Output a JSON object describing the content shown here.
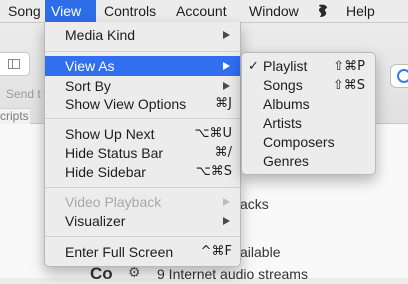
{
  "menubar": {
    "items": [
      {
        "label": "Song"
      },
      {
        "label": "View"
      },
      {
        "label": "Controls"
      },
      {
        "label": "Account"
      },
      {
        "label": "Window"
      },
      {
        "label": "Help"
      }
    ],
    "script_icon": "scroll-icon"
  },
  "background": {
    "send_to": "Send t",
    "scripts": "cripts",
    "lines": [
      "acks",
      "ailable",
      "Co",
      "9 Internet audio streams"
    ]
  },
  "view_menu": {
    "items": [
      {
        "label": "Media Kind",
        "shortcut": "",
        "submenu": true
      },
      {
        "label": "View As",
        "shortcut": "",
        "submenu": true
      },
      {
        "label": "Sort By",
        "shortcut": "",
        "submenu": true
      },
      {
        "label": "Show View Options",
        "shortcut": "⌘J",
        "submenu": false
      },
      {
        "label": "Show Up Next",
        "shortcut": "⌥⌘U",
        "submenu": false
      },
      {
        "label": "Hide Status Bar",
        "shortcut": "⌘/",
        "submenu": false
      },
      {
        "label": "Hide Sidebar",
        "shortcut": "⌥⌘S",
        "submenu": false
      },
      {
        "label": "Video Playback",
        "shortcut": "",
        "submenu": true
      },
      {
        "label": "Visualizer",
        "shortcut": "",
        "submenu": true
      },
      {
        "label": "Enter Full Screen",
        "shortcut": "^⌘F",
        "submenu": false
      }
    ]
  },
  "view_as_submenu": {
    "items": [
      {
        "label": "Playlist",
        "shortcut": "⇧⌘P",
        "checked": true
      },
      {
        "label": "Songs",
        "shortcut": "⇧⌘S",
        "checked": false
      },
      {
        "label": "Albums",
        "shortcut": "",
        "checked": false
      },
      {
        "label": "Artists",
        "shortcut": "",
        "checked": false
      },
      {
        "label": "Composers",
        "shortcut": "",
        "checked": false
      },
      {
        "label": "Genres",
        "shortcut": "",
        "checked": false
      }
    ],
    "check_mark": "✓"
  },
  "colors": {
    "highlight": "#2f6ff0",
    "menubar_active": "#2d6ee8",
    "disabled_text": "#a8a8a8"
  }
}
